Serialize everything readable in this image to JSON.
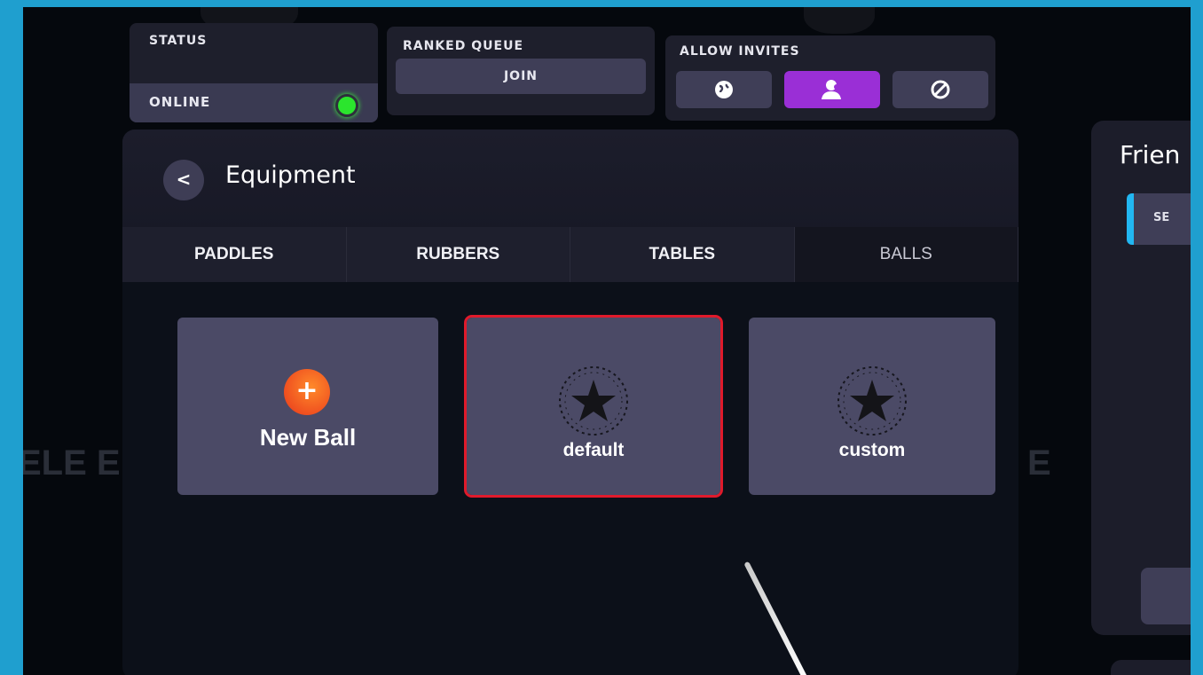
{
  "status_panel": {
    "title": "STATUS",
    "value": "ONLINE",
    "indicator_color": "#2be52d"
  },
  "ranked_queue": {
    "title": "RANKED QUEUE",
    "button_label": "JOIN"
  },
  "allow_invites": {
    "title": "ALLOW INVITES",
    "options": [
      {
        "icon": "globe-icon",
        "active": false
      },
      {
        "icon": "friends-icon",
        "active": true
      },
      {
        "icon": "block-icon",
        "active": false
      }
    ],
    "active_color": "#9a2fd6"
  },
  "equipment": {
    "title": "Equipment",
    "back_label": "<",
    "tabs": [
      "PADDLES",
      "RUBBERS",
      "TABLES",
      "BALLS"
    ],
    "active_tab": "BALLS",
    "new_item": {
      "plus": "+",
      "label": "New Ball"
    },
    "items": [
      {
        "label": "default",
        "selected": true
      },
      {
        "label": "custom",
        "selected": false
      }
    ],
    "selected_color": "#e01a2b"
  },
  "friends": {
    "title": "Frien",
    "search_label": "SE"
  },
  "background_text": {
    "left": "ELE E",
    "right": "E"
  }
}
